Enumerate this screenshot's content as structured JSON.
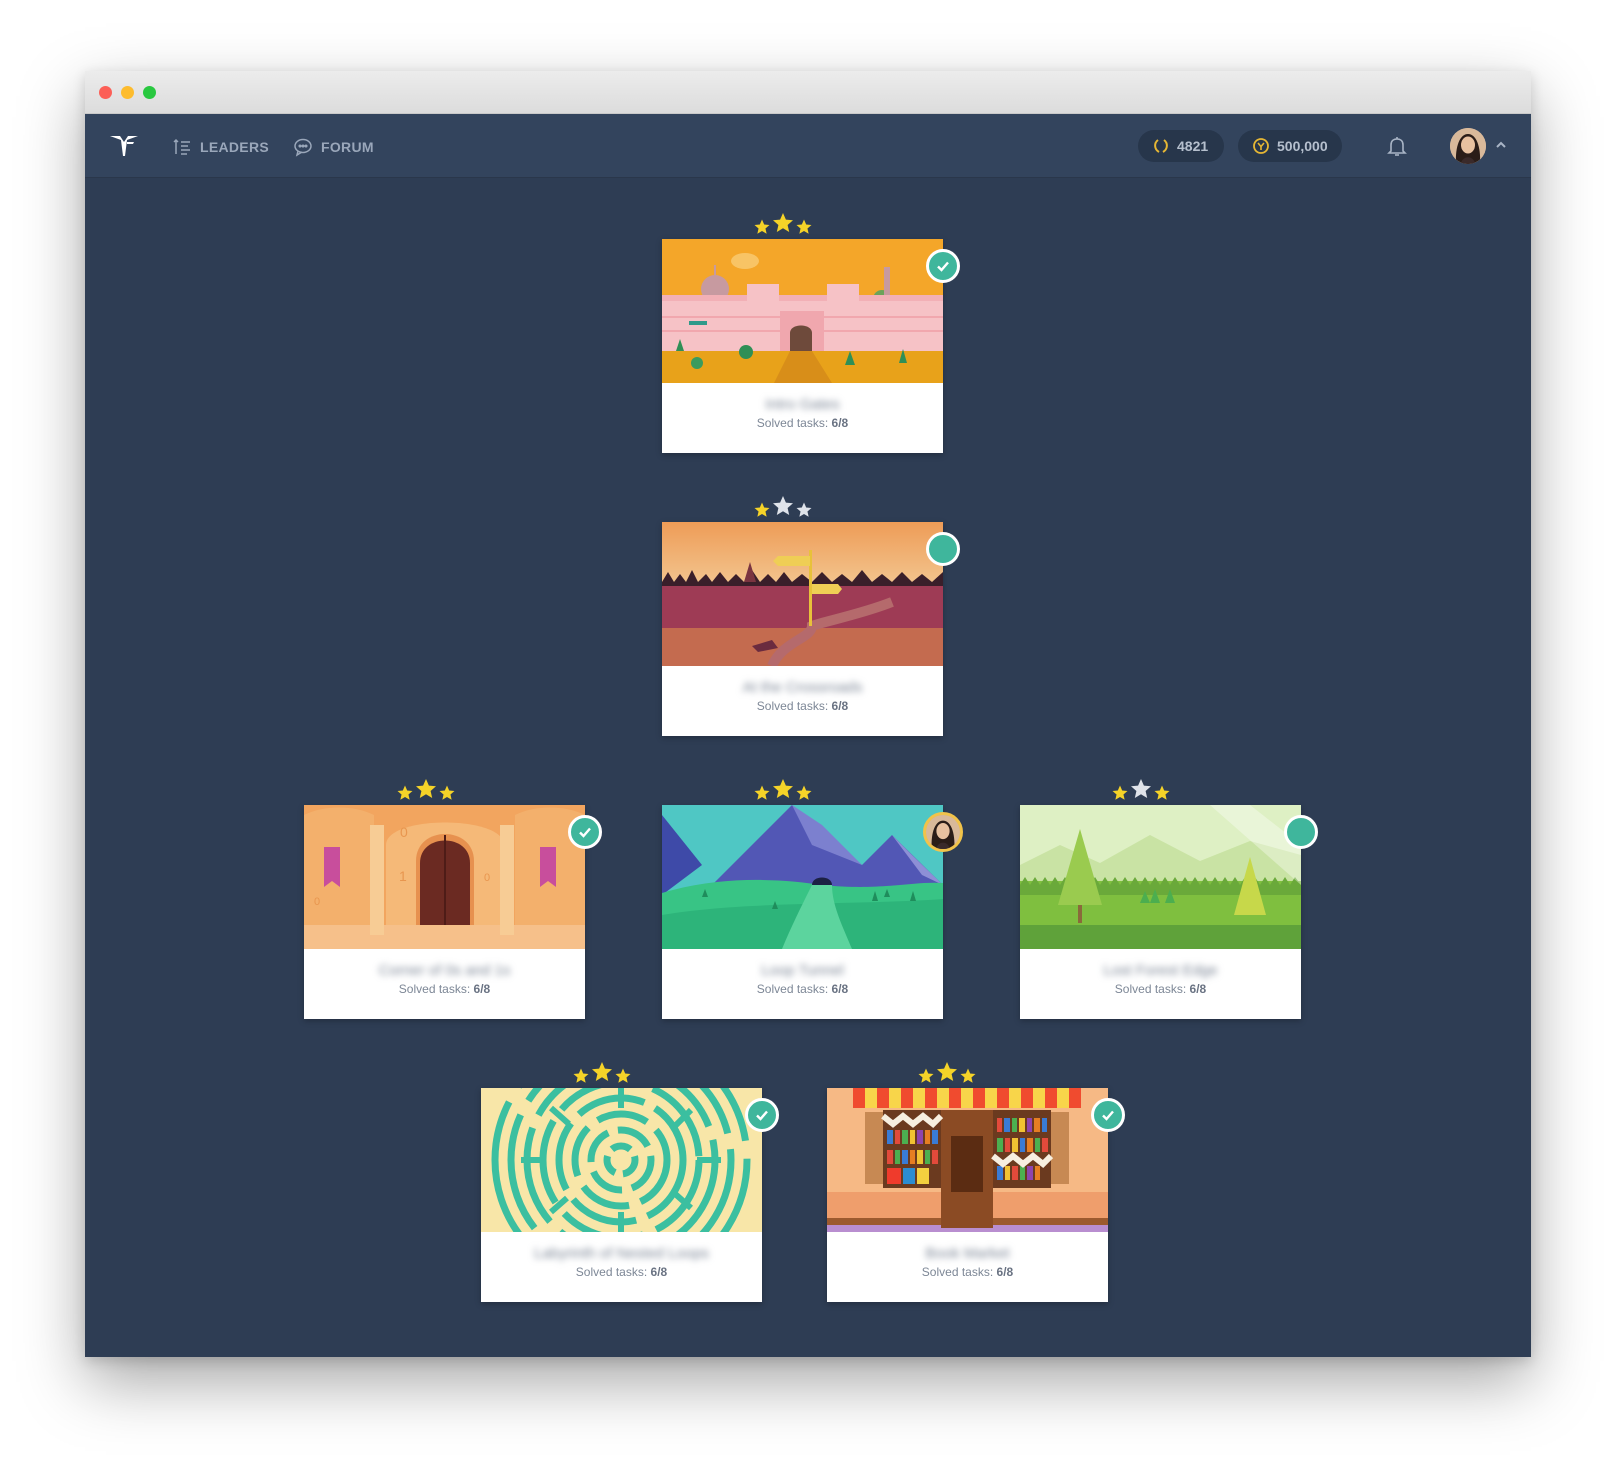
{
  "nav": {
    "leaders_label": "LEADERS",
    "forum_label": "FORUM",
    "rating_value": "4821",
    "coins_value": "500,000",
    "icons": [
      "logo-icon",
      "leaders-icon",
      "forum-icon",
      "laurel-icon",
      "coin-icon",
      "bell-icon",
      "chevron-up-icon"
    ]
  },
  "colors": {
    "background": "#2e3d54",
    "navbar": "#33445d",
    "accent_green": "#3fb69c",
    "star_gold": "#f5d328",
    "star_grey": "#dfe3ea"
  },
  "levels": [
    {
      "name": "Intro Gates",
      "tasks_label": "Solved tasks:",
      "tasks_value": "6/8",
      "stars_earned": 3,
      "status": "completed"
    },
    {
      "name": "At the Crossroads",
      "tasks_label": "Solved tasks:",
      "tasks_value": "6/8",
      "stars_earned": 1,
      "status": "in-progress"
    },
    {
      "name": "Corner of 0s and 1s",
      "tasks_label": "Solved tasks:",
      "tasks_value": "6/8",
      "stars_earned": 3,
      "status": "completed"
    },
    {
      "name": "Loop Tunnel",
      "tasks_label": "Solved tasks:",
      "tasks_value": "6/8",
      "stars_earned": 3,
      "status": "current-user"
    },
    {
      "name": "Lost Forest Edge",
      "tasks_label": "Solved tasks:",
      "tasks_value": "6/8",
      "stars_earned": 2,
      "status": "in-progress"
    },
    {
      "name": "Labyrinth of Nested Loops",
      "tasks_label": "Solved tasks:",
      "tasks_value": "6/8",
      "stars_earned": 3,
      "status": "completed"
    },
    {
      "name": "Book Market",
      "tasks_label": "Solved tasks:",
      "tasks_value": "6/8",
      "stars_earned": 3,
      "status": "completed"
    }
  ]
}
